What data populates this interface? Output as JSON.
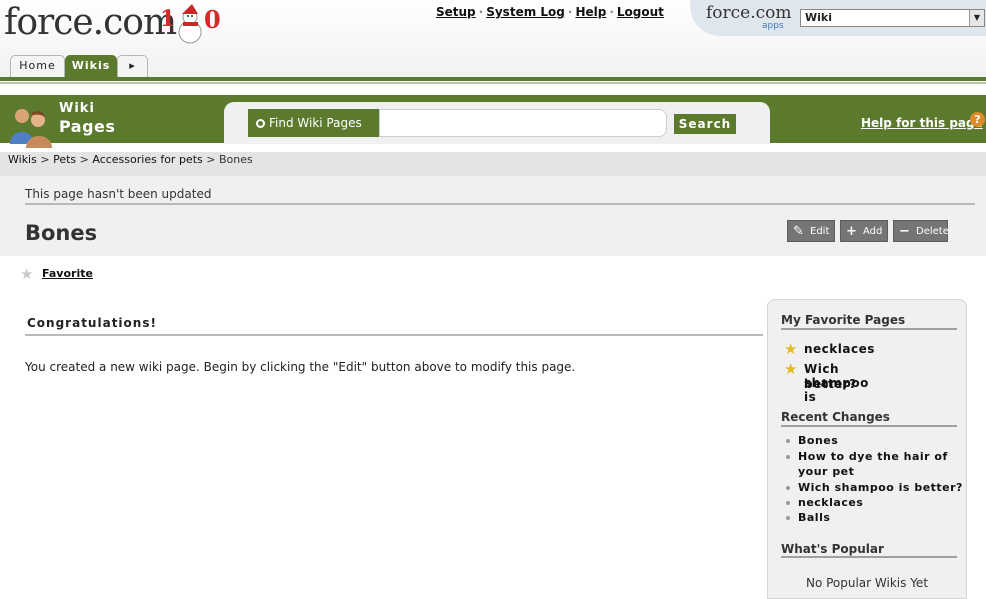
{
  "header": {
    "logo_text": "force.com",
    "top_links": [
      "Setup",
      "System Log",
      "Help",
      "Logout"
    ],
    "app_logo": "force.com",
    "app_logo_sub": "apps",
    "app_selected": "Wiki"
  },
  "tabs": [
    {
      "label": "Home",
      "active": false
    },
    {
      "label": "Wikis",
      "active": true
    },
    {
      "label": "▸",
      "active": false
    }
  ],
  "band": {
    "title_line1": "Wiki",
    "title_line2": "Pages",
    "search_label": "Find Wiki Pages",
    "search_value": "",
    "search_button": "Search",
    "help_link": "Help for this page",
    "help_icon": "?"
  },
  "breadcrumb": {
    "items": [
      "Wikis",
      "Pets",
      "Accessories for pets"
    ],
    "separator": ">",
    "current": "Bones"
  },
  "page": {
    "updated_text": "This page hasn't been updated",
    "title": "Bones",
    "actions": [
      "Edit",
      "Add",
      "Delete"
    ],
    "favorite_label": "Favorite",
    "section_heading": "Congratulations!",
    "body": "You created a new wiki page. Begin by clicking the \"Edit\" button above to modify this page."
  },
  "sidebar": {
    "favorites_heading": "My Favorite Pages",
    "favorites": [
      "necklaces",
      "Wich shampoo is",
      "better?"
    ],
    "recent_heading": "Recent Changes",
    "recent": [
      "Bones",
      "How to dye the hair of",
      "your pet",
      "Wich shampoo is better?",
      "necklaces",
      "Balls"
    ],
    "popular_heading": "What's Popular",
    "popular_empty": "No Popular Wikis Yet"
  },
  "colors": {
    "brand_green": "#5b7a2e",
    "star_gold": "#e4b824",
    "help_orange": "#e08a2a"
  }
}
